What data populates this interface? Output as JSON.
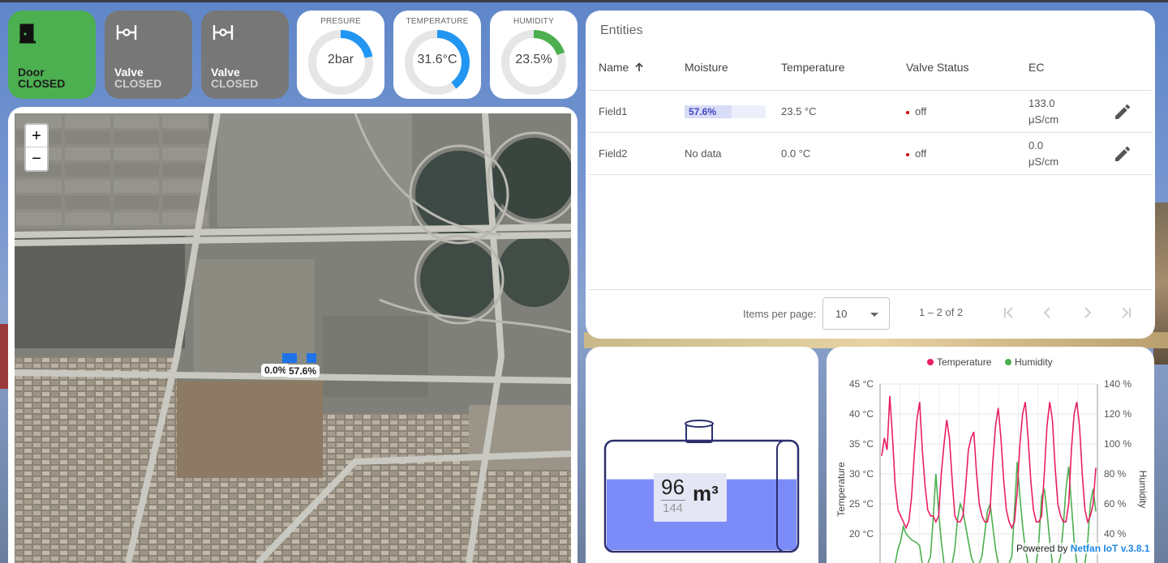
{
  "tiles": [
    {
      "title": "Door",
      "status": "CLOSED",
      "icon": "door-icon"
    },
    {
      "title": "Valve",
      "status": "CLOSED",
      "icon": "valve-icon"
    },
    {
      "title": "Valve",
      "status": "CLOSED",
      "icon": "valve-icon"
    }
  ],
  "gauges": [
    {
      "label": "PRESURE",
      "value": "2bar",
      "fraction": 0.22,
      "color": "#2196f3"
    },
    {
      "label": "TEMPERATURE",
      "value": "31.6°C",
      "fraction": 0.4,
      "color": "#2196f3"
    },
    {
      "label": "HUMIDITY",
      "value": "23.5%",
      "fraction": 0.2,
      "color": "#4caf50"
    }
  ],
  "map": {
    "zoom_in": "+",
    "zoom_out": "−",
    "markers": [
      "0.0%",
      "57.6%"
    ]
  },
  "entities": {
    "title": "Entities",
    "columns": {
      "name": "Name",
      "moisture": "Moisture",
      "temperature": "Temperature",
      "valve": "Valve Status",
      "ec": "EC"
    },
    "sort_icon": "arrow-up-icon",
    "rows": [
      {
        "name": "Field1",
        "moisture": "57.6%",
        "moisture_fraction": 0.576,
        "temperature": "23.5 °C",
        "valve": "off",
        "ec_value": "133.0",
        "ec_unit": "μS/cm"
      },
      {
        "name": "Field2",
        "moisture": "No data",
        "temperature": "0.0 °C",
        "valve": "off",
        "ec_value": "0.0",
        "ec_unit": "μS/cm"
      }
    ],
    "pager": {
      "items_per_page_label": "Items per page:",
      "items_per_page": "10",
      "range": "1 – 2 of 2"
    }
  },
  "tank": {
    "value": "96",
    "max": "144",
    "unit": "m³",
    "fill_fraction": 0.667,
    "color": "#7b8cf9"
  },
  "chart": {
    "powered_prefix": "Powered by",
    "powered_brand": "Netfan IoT v.3.8.1"
  },
  "chart_data": {
    "type": "line",
    "series": [
      {
        "name": "Temperature",
        "color": "#e91e63",
        "axis": "left",
        "values": [
          33,
          36,
          34,
          43,
          36,
          28,
          24,
          23,
          22,
          21,
          22,
          26,
          33,
          39,
          42,
          34,
          28,
          24,
          23,
          23,
          22,
          23,
          30,
          35,
          39,
          36,
          29,
          23,
          22,
          22,
          23,
          28,
          34,
          36,
          37,
          30,
          25,
          23,
          22,
          22,
          24,
          32,
          38,
          41,
          36,
          29,
          24,
          22,
          21,
          22,
          27,
          35,
          40,
          42,
          36,
          29,
          24,
          22,
          22,
          23,
          30,
          38,
          42,
          39,
          31,
          25,
          23,
          22,
          22,
          25,
          34,
          40,
          42,
          38,
          30,
          24,
          22,
          23,
          25,
          31
        ]
      },
      {
        "name": "Humidity",
        "color": "#4caf50",
        "axis": "right",
        "values": [
          10,
          10,
          20,
          20,
          20,
          20,
          30,
          35,
          45,
          40,
          38,
          36,
          35,
          34,
          32,
          20,
          20,
          20,
          25,
          50,
          80,
          55,
          35,
          20,
          20,
          20,
          20,
          30,
          50,
          60,
          55,
          45,
          35,
          25,
          20,
          20,
          20,
          25,
          40,
          55,
          60,
          45,
          30,
          20,
          18,
          18,
          20,
          20,
          25,
          55,
          88,
          65,
          45,
          30,
          20,
          20,
          18,
          20,
          35,
          65,
          70,
          55,
          35,
          20,
          18,
          18,
          25,
          45,
          70,
          85,
          60,
          35,
          20,
          20,
          18,
          20,
          35,
          60,
          70,
          55
        ]
      }
    ],
    "left_axis": {
      "label": "Temperature",
      "ticks": [
        "45 °C",
        "40 °C",
        "35 °C",
        "30 °C",
        "25 °C",
        "20 °C"
      ],
      "ylim": [
        17,
        45
      ]
    },
    "right_axis": {
      "label": "Humidity",
      "ticks": [
        "140 %",
        "120 %",
        "100 %",
        "80 %",
        "60 %",
        "40 %"
      ],
      "ylim": [
        25,
        140
      ]
    },
    "grid": true,
    "legend": "top"
  }
}
